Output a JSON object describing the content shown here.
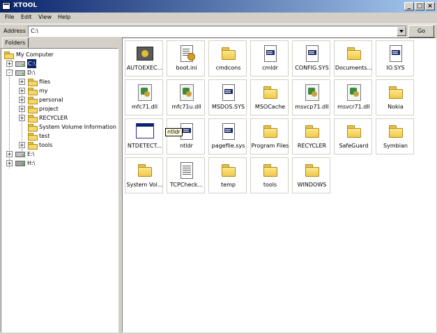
{
  "window": {
    "title": "XTOOL",
    "controls": {
      "minimize": "_",
      "maximize": "□",
      "close": "×"
    }
  },
  "menu": [
    {
      "label": "File"
    },
    {
      "label": "Edit"
    },
    {
      "label": "View"
    },
    {
      "label": "Help"
    }
  ],
  "address": {
    "label": "Address",
    "value": "C:\\",
    "go_label": "Go"
  },
  "left": {
    "tab_label": "Folders"
  },
  "tree": {
    "root": "My Computer",
    "items": [
      {
        "label": "C:\\",
        "type": "drive",
        "expander": "+",
        "selected": true
      },
      {
        "label": "D:\\",
        "type": "drive",
        "expander": "-"
      },
      {
        "label": "files",
        "type": "folder",
        "expander": "+"
      },
      {
        "label": "my",
        "type": "folder",
        "expander": "+"
      },
      {
        "label": "personal",
        "type": "folder",
        "expander": "+"
      },
      {
        "label": "project",
        "type": "folder",
        "expander": "+"
      },
      {
        "label": "RECYCLER",
        "type": "folder",
        "expander": "+"
      },
      {
        "label": "System Volume Information",
        "type": "folder",
        "expander": ""
      },
      {
        "label": "test",
        "type": "folder",
        "expander": ""
      },
      {
        "label": "tools",
        "type": "folder",
        "expander": "+"
      },
      {
        "label": "E:\\",
        "type": "drive",
        "expander": "+"
      },
      {
        "label": "H:\\",
        "type": "drive",
        "expander": "+"
      }
    ]
  },
  "files": [
    {
      "label": "AUTOEXEC...",
      "icon": "batch-file-icon"
    },
    {
      "label": "boot.ini",
      "icon": "ini-file-icon"
    },
    {
      "label": "cmdcons",
      "icon": "folder-icon"
    },
    {
      "label": "cmldr",
      "icon": "system-file-icon"
    },
    {
      "label": "CONFIG.SYS",
      "icon": "system-file-icon"
    },
    {
      "label": "Documents...",
      "icon": "folder-icon"
    },
    {
      "label": "IO.SYS",
      "icon": "system-file-icon"
    },
    {
      "label": "mfc71.dll",
      "icon": "dll-file-icon"
    },
    {
      "label": "mfc71u.dll",
      "icon": "dll-file-icon"
    },
    {
      "label": "MSDOS.SYS",
      "icon": "system-file-icon"
    },
    {
      "label": "MSOCache",
      "icon": "folder-icon"
    },
    {
      "label": "msvcp71.dll",
      "icon": "dll-file-icon"
    },
    {
      "label": "msvcr71.dll",
      "icon": "dll-file-icon"
    },
    {
      "label": "Nokia",
      "icon": "folder-icon"
    },
    {
      "label": "NTDETECT...",
      "icon": "application-icon"
    },
    {
      "label": "ntldr",
      "icon": "system-file-icon"
    },
    {
      "label": "pagefile.sys",
      "icon": "system-file-icon"
    },
    {
      "label": "Program Files",
      "icon": "folder-icon"
    },
    {
      "label": "RECYCLER",
      "icon": "folder-icon"
    },
    {
      "label": "SafeGuard",
      "icon": "folder-icon"
    },
    {
      "label": "Symbian",
      "icon": "folder-icon"
    },
    {
      "label": "System Vol...",
      "icon": "folder-icon"
    },
    {
      "label": "TCPCheck...",
      "icon": "text-file-icon"
    },
    {
      "label": "temp",
      "icon": "folder-icon"
    },
    {
      "label": "tools",
      "icon": "folder-icon"
    },
    {
      "label": "WINDOWS",
      "icon": "folder-icon"
    }
  ],
  "tooltip": "ntldr"
}
